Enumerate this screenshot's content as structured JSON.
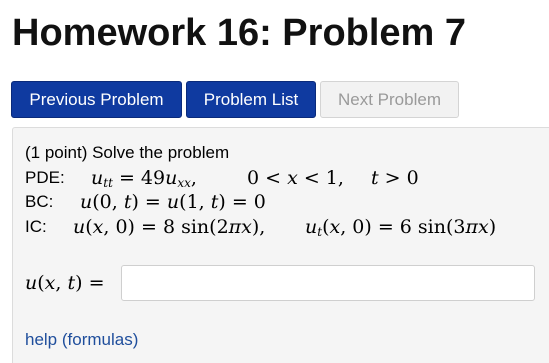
{
  "page": {
    "title": "Homework 16: Problem 7"
  },
  "nav": {
    "previous_label": "Previous Problem",
    "list_label": "Problem List",
    "next_label": "Next Problem"
  },
  "problem": {
    "intro": "(1 point) Solve the problem",
    "pde_label": "PDE:",
    "pde_eq": "u_tt = 49u_xx,",
    "pde_domain_x": "0 < x < 1,",
    "pde_domain_t": "t > 0",
    "bc_label": "BC:",
    "bc_eq": "u(0, t) = u(1, t) = 0",
    "ic_label": "IC:",
    "ic_eq1": "u(x, 0) = 8 sin(2πx),",
    "ic_eq2": "u_t(x, 0) = 6 sin(3πx)",
    "answer_label": "u(x, t) =",
    "answer_value": "",
    "help_link": "help (formulas)"
  },
  "colors": {
    "primary_button": "#0f3aa0",
    "disabled_button": "#f2f2f2",
    "panel_bg": "#f5f5f5",
    "link": "#1f4e9c"
  }
}
